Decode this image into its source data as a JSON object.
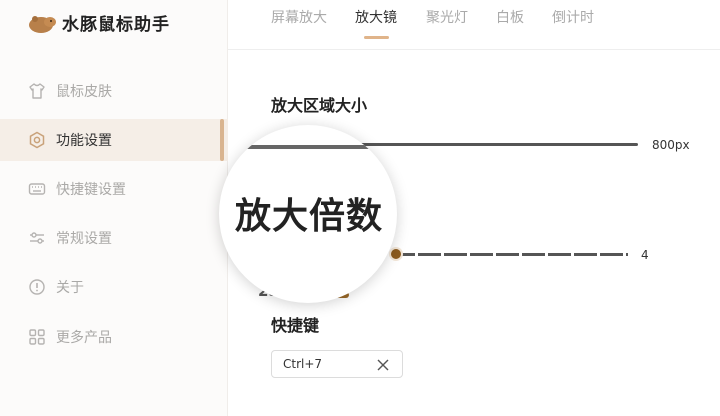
{
  "app": {
    "title": "水豚鼠标助手"
  },
  "sidebar": {
    "items": [
      {
        "label": "鼠标皮肤",
        "icon": "shirt-icon"
      },
      {
        "label": "功能设置",
        "icon": "hexagon-settings-icon",
        "active": true
      },
      {
        "label": "快捷键设置",
        "icon": "keyboard-icon"
      },
      {
        "label": "常规设置",
        "icon": "sliders-icon"
      },
      {
        "label": "关于",
        "icon": "info-icon"
      },
      {
        "label": "更多产品",
        "icon": "apps-grid-icon"
      }
    ]
  },
  "tabs": [
    {
      "label": "屏幕放大"
    },
    {
      "label": "放大镜",
      "active": true
    },
    {
      "label": "聚光灯"
    },
    {
      "label": "白板"
    },
    {
      "label": "倒计时"
    }
  ],
  "magnify_area": {
    "title": "放大区域大小",
    "value_label": "800px"
  },
  "magnify_factor": {
    "title": "放大倍数",
    "value_label": "4",
    "partial_value": "25"
  },
  "shortcut": {
    "title": "快捷键",
    "value": "Ctrl+7"
  },
  "colors": {
    "accent": "#e0b48a",
    "knob": "#8b5a1e",
    "active_bg": "#f5eee7"
  }
}
